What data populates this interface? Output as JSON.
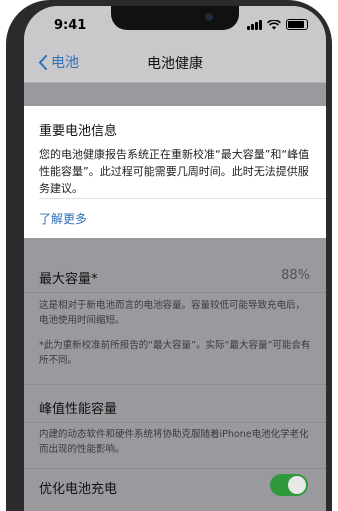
{
  "status_bar": {
    "time": "9:41"
  },
  "nav": {
    "back_label": "电池",
    "title": "电池健康"
  },
  "info_card": {
    "title": "重要电池信息",
    "body": "您的电池健康报告系统正在重新校准“最大容量”和“峰值性能容量”。此过程可能需要几周时间。此时无法提供服务建议。",
    "learn_more": "了解更多"
  },
  "max_capacity": {
    "label": "最大容量*",
    "value": "88%",
    "note1": "这是相对于新电池而言的电池容量。容量较低可能导致充电后，电池使用时间缩短。",
    "note2": "*此为重新校准前所报告的“最大容量”。实际“最大容量”可能会有所不同。"
  },
  "peak_performance": {
    "label": "峰值性能容量",
    "note": "内建的动态软件和硬件系统将协助克服随着iPhone电池化学老化而出现的性能影响。"
  },
  "optimized_charging": {
    "label": "优化电池充电",
    "enabled": true
  },
  "colors": {
    "accent": "#2f6fb8",
    "toggle_on": "#2f9a3c"
  }
}
